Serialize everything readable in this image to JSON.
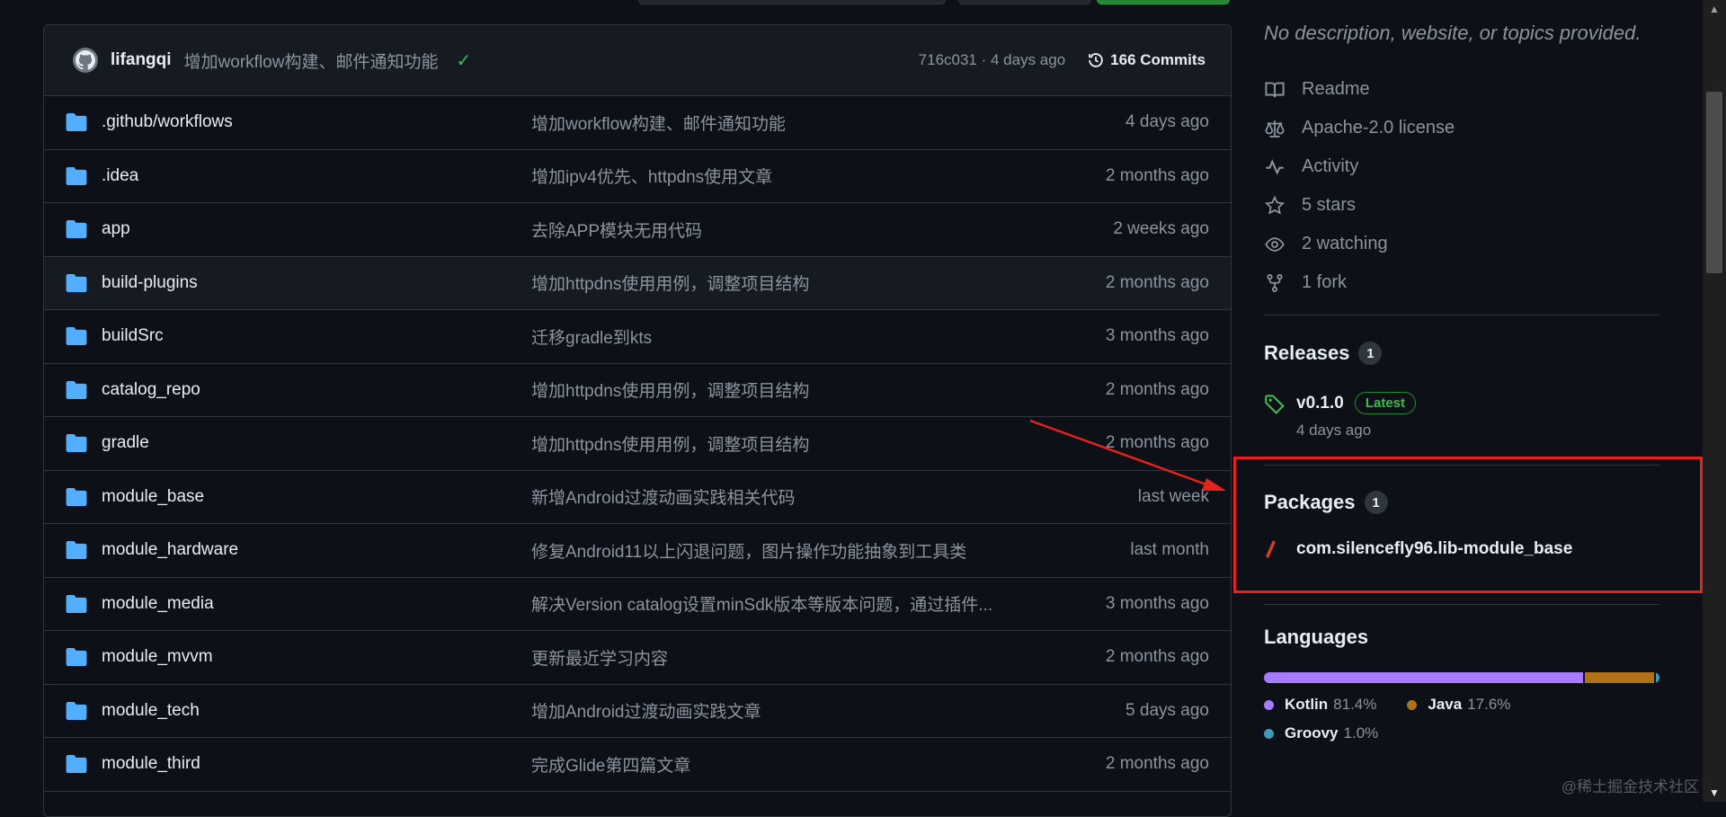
{
  "colors": {
    "page_bg": "#0d1117",
    "border": "#30363d",
    "muted": "#8b949e",
    "folder": "#54aeff",
    "success": "#3fb950",
    "annotation_red": "#e5221b"
  },
  "latest_commit": {
    "author": "lifangqi",
    "message": "增加workflow构建、邮件通知功能",
    "status_icon": "check-icon",
    "hash_age": "716c031 · 4 days ago",
    "commits_label": "166 Commits"
  },
  "files": [
    {
      "name": ".github/workflows",
      "message": "增加workflow构建、邮件通知功能",
      "age": "4 days ago"
    },
    {
      "name": ".idea",
      "message": "增加ipv4优先、httpdns使用文章",
      "age": "2 months ago"
    },
    {
      "name": "app",
      "message": "去除APP模块无用代码",
      "age": "2 weeks ago"
    },
    {
      "name": "build-plugins",
      "message": "增加httpdns使用用例，调整项目结构",
      "age": "2 months ago"
    },
    {
      "name": "buildSrc",
      "message": "迁移gradle到kts",
      "age": "3 months ago"
    },
    {
      "name": "catalog_repo",
      "message": "增加httpdns使用用例，调整项目结构",
      "age": "2 months ago"
    },
    {
      "name": "gradle",
      "message": "增加httpdns使用用例，调整项目结构",
      "age": "2 months ago"
    },
    {
      "name": "module_base",
      "message": "新增Android过渡动画实践相关代码",
      "age": "last week"
    },
    {
      "name": "module_hardware",
      "message": "修复Android11以上闪退问题，图片操作功能抽象到工具类",
      "age": "last month"
    },
    {
      "name": "module_media",
      "message": "解决Version catalog设置minSdk版本等版本问题，通过插件...",
      "age": "3 months ago"
    },
    {
      "name": "module_mvvm",
      "message": "更新最近学习内容",
      "age": "2 months ago"
    },
    {
      "name": "module_tech",
      "message": "增加Android过渡动画实践文章",
      "age": "5 days ago"
    },
    {
      "name": "module_third",
      "message": "完成Glide第四篇文章",
      "age": "2 months ago"
    }
  ],
  "about": {
    "description": "No description, website, or topics provided.",
    "items": [
      {
        "icon": "book-icon",
        "label": "Readme"
      },
      {
        "icon": "scale-icon",
        "label": "Apache-2.0 license"
      },
      {
        "icon": "pulse-icon",
        "label": "Activity"
      },
      {
        "icon": "star-icon",
        "label": "5 stars"
      },
      {
        "icon": "eye-icon",
        "label": "2 watching"
      },
      {
        "icon": "fork-icon",
        "label": "1 fork"
      }
    ]
  },
  "releases": {
    "title": "Releases",
    "count": "1",
    "tag": "v0.1.0",
    "badge": "Latest",
    "date": "4 days ago"
  },
  "packages": {
    "title": "Packages",
    "count": "1",
    "name": "com.silencefly96.lib-module_base"
  },
  "languages": {
    "title": "Languages",
    "items": [
      {
        "name": "Kotlin",
        "percent": "81.4%",
        "value": 81.4,
        "color": "#a97bff"
      },
      {
        "name": "Java",
        "percent": "17.6%",
        "value": 17.6,
        "color": "#b07219"
      },
      {
        "name": "Groovy",
        "percent": "1.0%",
        "value": 1.0,
        "color": "#4298b8"
      }
    ]
  },
  "watermark": "@稀土掘金技术社区"
}
